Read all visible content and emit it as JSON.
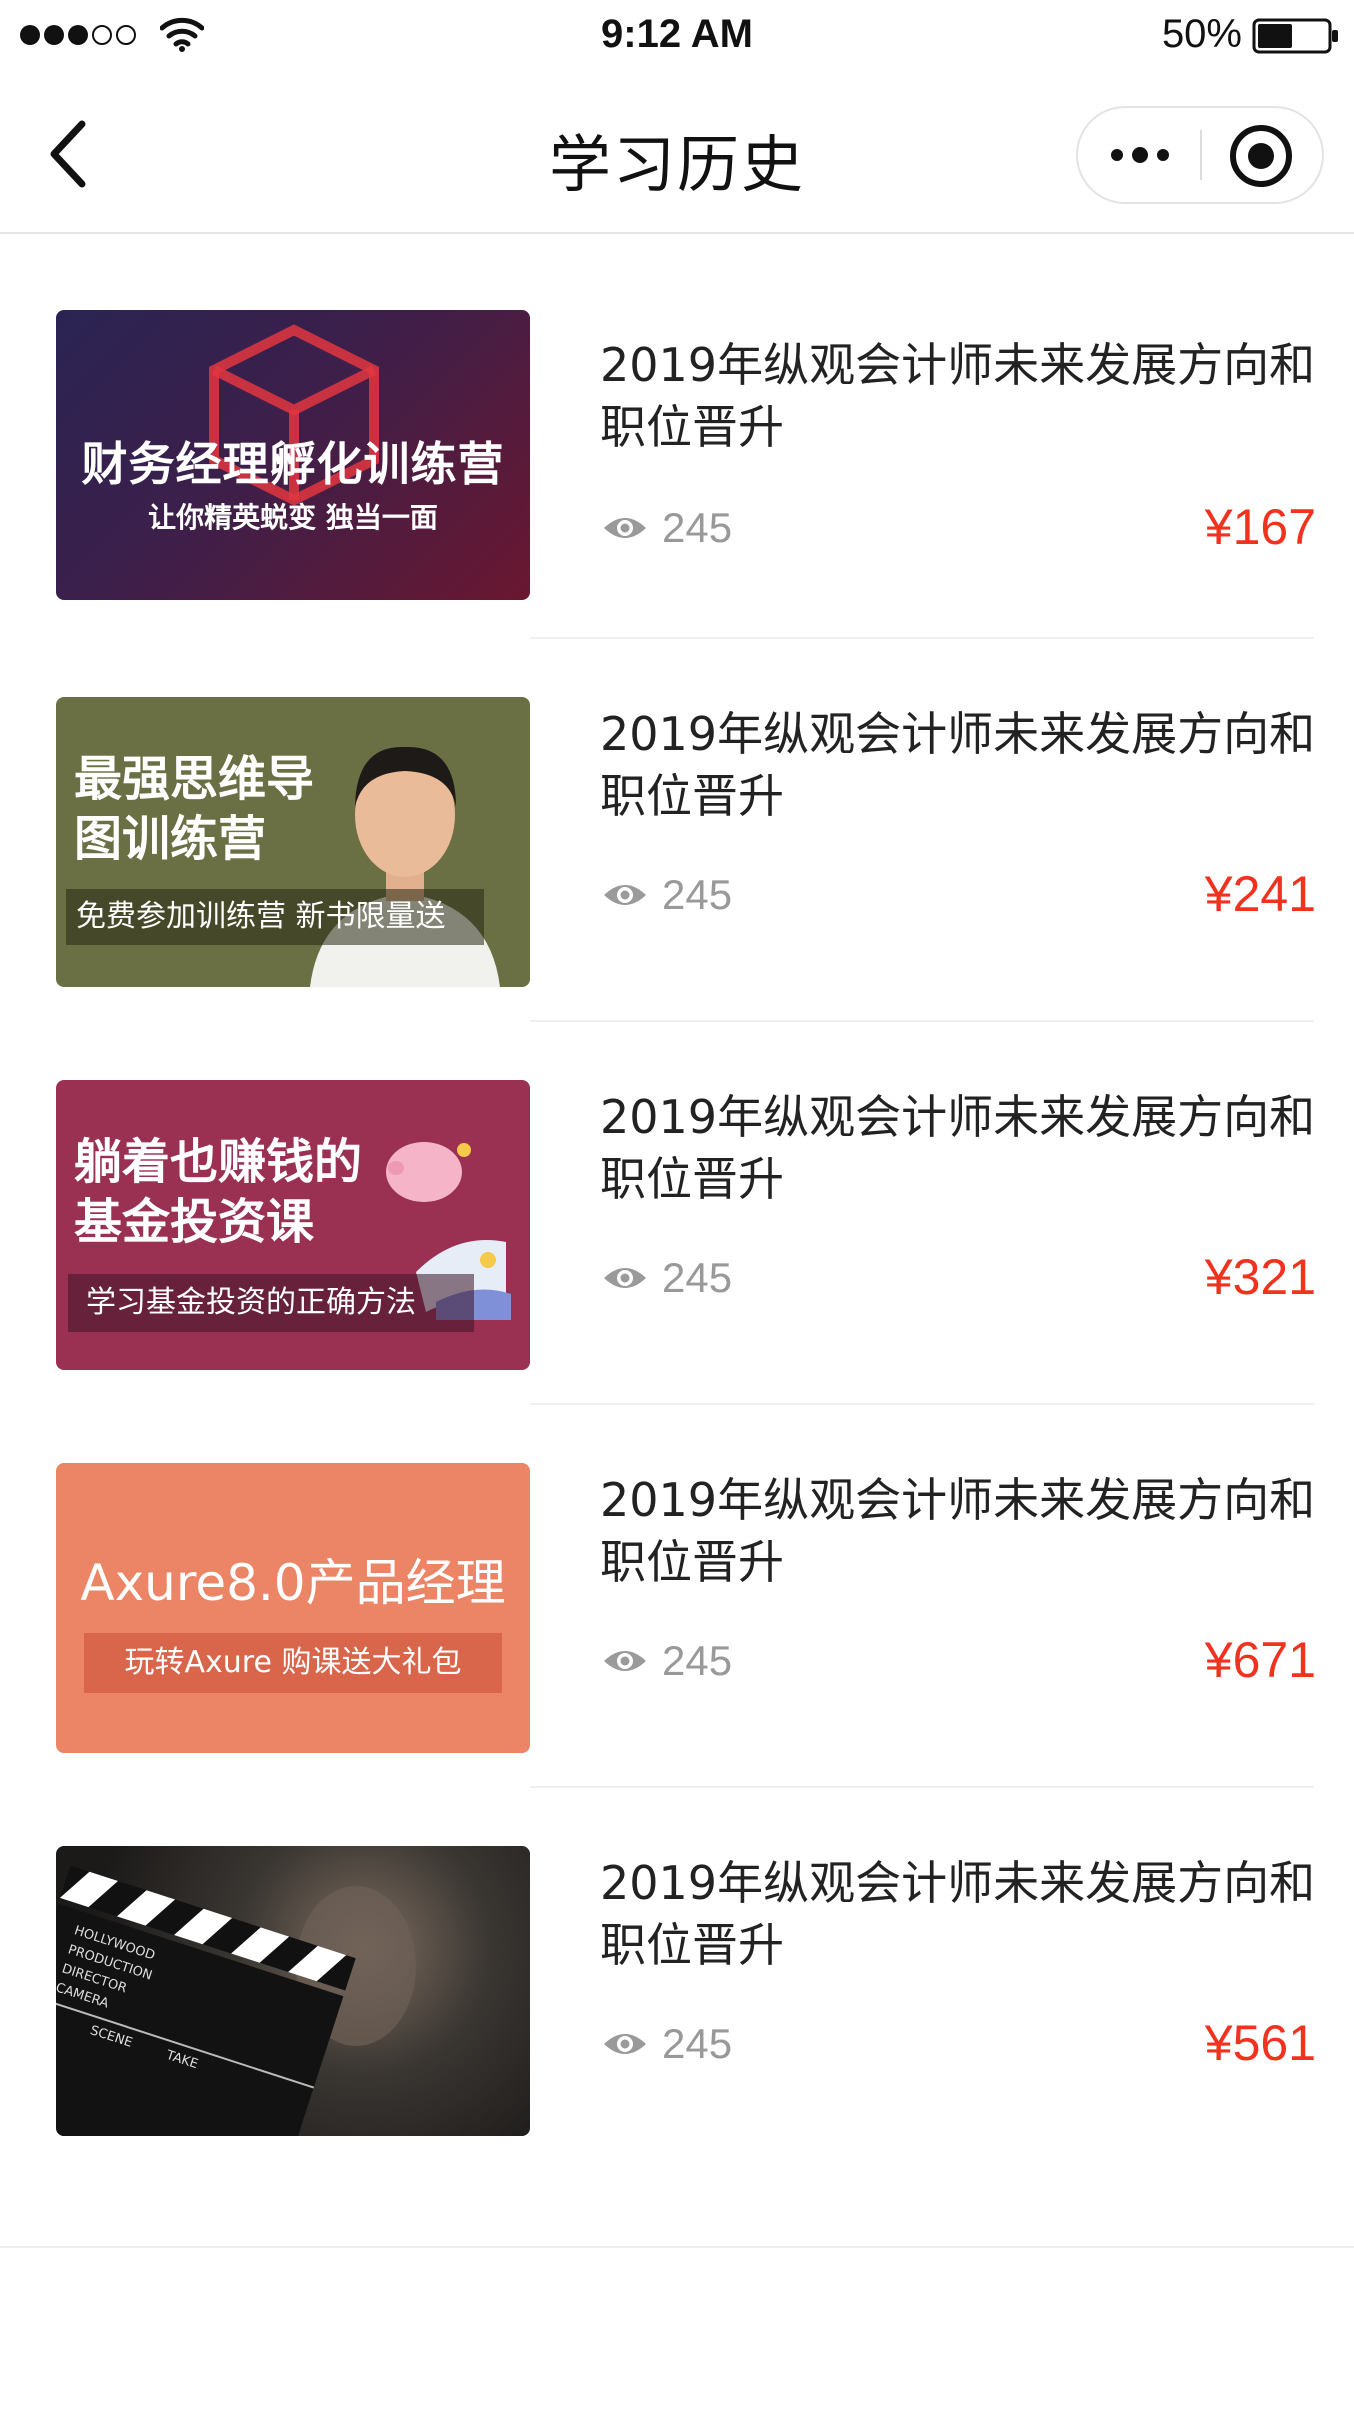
{
  "status_bar": {
    "time": "9:12 AM",
    "battery_text": "50%",
    "battery_level": 0.5
  },
  "nav": {
    "title": "学习历史"
  },
  "courses": [
    {
      "title": "2019年纵观会计师未来发展方向和职位晋升",
      "views": "245",
      "price": "¥167",
      "cover": {
        "theme": "finance-manager",
        "line1": "财务经理孵化训练营",
        "line2": "让你精英蜕变 独当一面"
      }
    },
    {
      "title": "2019年纵观会计师未来发展方向和职位晋升",
      "views": "245",
      "price": "¥241",
      "cover": {
        "theme": "mind-map",
        "line1": "最强思维导图训练营",
        "line2": "免费参加训练营 新书限量送"
      }
    },
    {
      "title": "2019年纵观会计师未来发展方向和职位晋升",
      "views": "245",
      "price": "¥321",
      "cover": {
        "theme": "fund-investing",
        "line1": "躺着也赚钱的基金投资课",
        "line2": "学习基金投资的正确方法"
      }
    },
    {
      "title": "2019年纵观会计师未来发展方向和职位晋升",
      "views": "245",
      "price": "¥671",
      "cover": {
        "theme": "axure",
        "line1": "Axure8.0产品经理",
        "line2": "玩转Axure 购课送大礼包"
      }
    },
    {
      "title": "2019年纵观会计师未来发展方向和职位晋升",
      "views": "245",
      "price": "¥561",
      "cover": {
        "theme": "film-clapperboard",
        "clapper_lines": [
          "HOLLYWOOD",
          "PRODUCTION",
          "DIRECTOR",
          "CAMERA",
          "SCENE",
          "TAKE"
        ]
      }
    }
  ],
  "colors": {
    "price": "#f0321e",
    "muted": "#999999",
    "divider": "#efefef"
  }
}
